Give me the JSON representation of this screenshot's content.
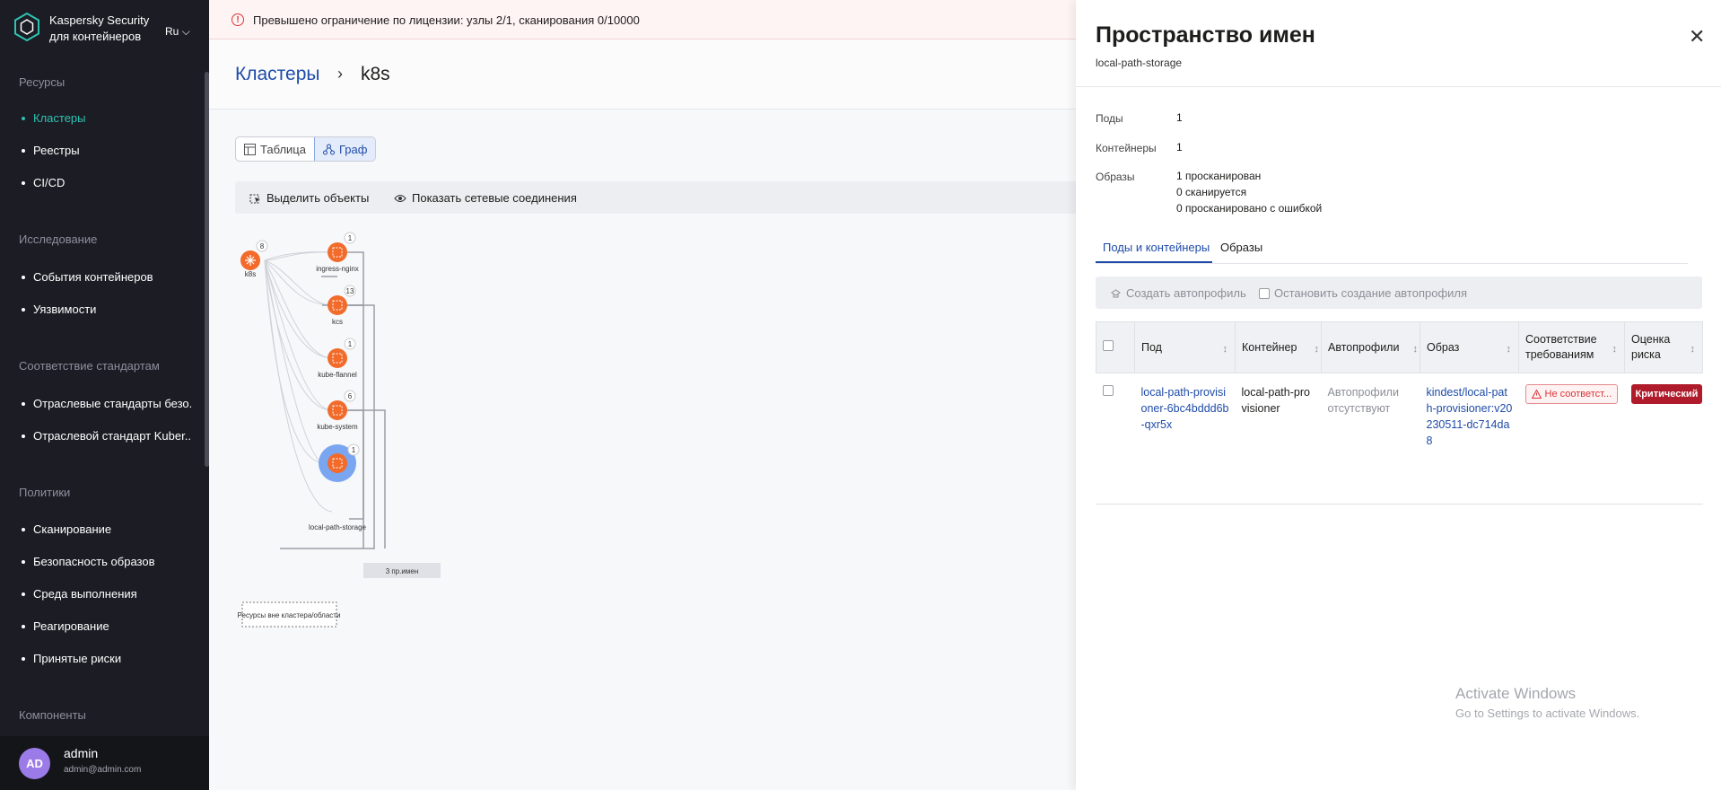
{
  "app": {
    "brand_line1": "Kaspersky Security",
    "brand_line2": "для контейнеров",
    "language": "Ru"
  },
  "sidebar": {
    "sections": [
      {
        "title": "Ресурсы",
        "items": [
          "Кластеры",
          "Реестры",
          "CI/CD"
        ]
      },
      {
        "title": "Исследование",
        "items": [
          "События контейнеров",
          "Уязвимости"
        ]
      },
      {
        "title": "Соответствие стандартам",
        "items": [
          "Отраслевые стандарты безо...",
          "Отраслевой стандарт Kuber..."
        ]
      },
      {
        "title": "Политики",
        "items": [
          "Сканирование",
          "Безопасность образов",
          "Среда выполнения",
          "Реагирование",
          "Принятые риски"
        ]
      },
      {
        "title": "Компоненты",
        "items": []
      }
    ],
    "active_item": "Кластеры"
  },
  "user": {
    "initials": "AD",
    "name": "admin",
    "email": "admin@admin.com"
  },
  "banner": {
    "text": "Превышено ограничение по лицензии: узлы 2/1, сканирования 0/10000"
  },
  "breadcrumb": {
    "parent": "Кластеры",
    "separator": "›",
    "current": "k8s"
  },
  "view_switch": {
    "table": "Таблица",
    "graph": "Граф",
    "selected": "Граф"
  },
  "toolbar": {
    "select_objects": "Выделить объекты",
    "show_network": "Показать сетевые соединения"
  },
  "graph": {
    "root": {
      "label": "k8s",
      "count": "8"
    },
    "nodes": [
      {
        "label": "ingress-nginx",
        "count": "1"
      },
      {
        "label": "kcs",
        "count": "13"
      },
      {
        "label": "kube-flannel",
        "count": "1"
      },
      {
        "label": "kube-system",
        "count": "6"
      },
      {
        "label": "local-path-storage",
        "count": "1",
        "selected": true
      }
    ],
    "more": "3 пр.имен",
    "external": "Ресурсы вне кластера/области"
  },
  "panel": {
    "title": "Пространство имен",
    "subtitle": "local-path-storage",
    "props": [
      {
        "label": "Поды",
        "values": [
          "1"
        ]
      },
      {
        "label": "Контейнеры",
        "values": [
          "1"
        ]
      },
      {
        "label": "Образы",
        "values": [
          "1 просканирован",
          "0 сканируется",
          "0 просканировано с ошибкой"
        ]
      }
    ],
    "tabs": [
      "Поды и контейнеры",
      "Образы"
    ],
    "active_tab": "Поды и контейнеры",
    "actions": {
      "create": "Создать автопрофиль",
      "stop": "Остановить создание автопрофиля"
    },
    "table": {
      "columns": [
        "Под",
        "Контейнер",
        "Автопрофили",
        "Образ",
        "Соответствие требованиям",
        "Оценка риска"
      ],
      "rows": [
        {
          "pod": "local-path-provisioner-6bc4bddd6b-qxr5x",
          "container": "local-path-provisioner",
          "autoprofiles": "Автопрофили отсутствуют",
          "image": "kindest/local-path-provisioner:v20230511-dc714da8",
          "compliance": "Не соответст...",
          "risk": "Критический"
        }
      ]
    }
  },
  "watermark": {
    "line1": "Activate Windows",
    "line2": "Go to Settings to activate Windows."
  },
  "colors": {
    "accent": "#1f4ba8",
    "sidebar": "#1b1c24",
    "active_nav": "#2ec2b2",
    "node": "#f26b2b",
    "critical": "#b01b2b"
  }
}
